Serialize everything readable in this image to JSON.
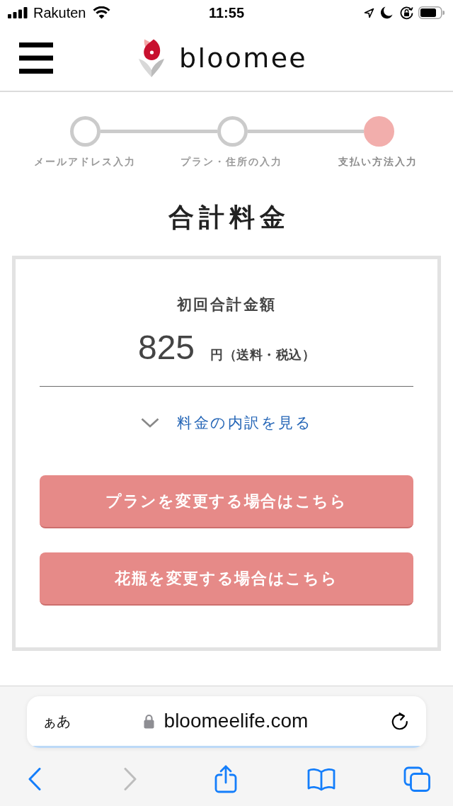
{
  "status_bar": {
    "carrier": "Rakuten",
    "time": "11:55"
  },
  "header": {
    "logo_text": "bloomee"
  },
  "steps": [
    {
      "label": "メールアドレス入力",
      "current": false
    },
    {
      "label": "プラン・住所の入力",
      "current": false
    },
    {
      "label": "支払い方法入力",
      "current": true
    }
  ],
  "title": "合計料金",
  "summary": {
    "label": "初回合計金額",
    "amount": "825",
    "unit": "円（送料・税込）",
    "breakdown_link": "料金の内訳を見る",
    "expanded": false
  },
  "buttons": [
    "プランを変更する場合はこちら",
    "花瓶を変更する場合はこちら"
  ],
  "browser": {
    "text_size_button": "ぁあ",
    "url": "bloomeelife.com",
    "load_progress": {
      "level": 1
    },
    "toolbar": [
      {
        "kind": "back",
        "disabled": false
      },
      {
        "kind": "forward",
        "disabled": true
      },
      {
        "kind": "share",
        "disabled": false
      },
      {
        "kind": "bookmarks",
        "disabled": false
      },
      {
        "kind": "tabs",
        "disabled": false
      }
    ]
  }
}
